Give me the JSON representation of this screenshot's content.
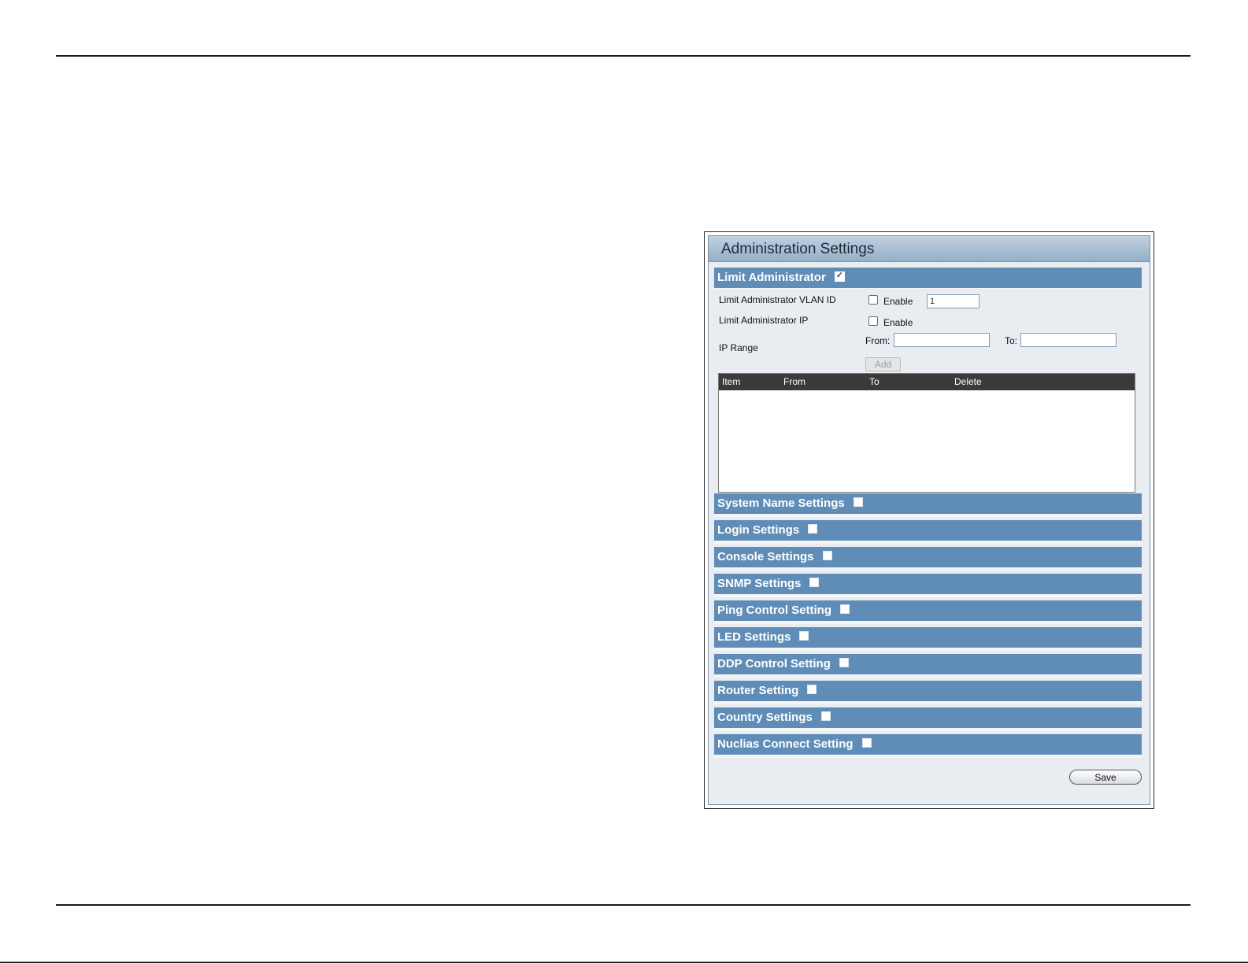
{
  "panel": {
    "title": "Administration Settings"
  },
  "limit_admin": {
    "title": "Limit Administrator",
    "checked": true,
    "vlan_label": "Limit Administrator VLAN ID",
    "vlan_enable_label": "Enable",
    "vlan_value": "1",
    "ip_label": "Limit Administrator IP",
    "ip_enable_label": "Enable",
    "range_label": "IP Range",
    "from_label": "From:",
    "to_label": "To:",
    "add_label": "Add",
    "table_headers": [
      "Item",
      "From",
      "To",
      "Delete"
    ]
  },
  "sections": [
    {
      "label": "System Name Settings"
    },
    {
      "label": "Login Settings"
    },
    {
      "label": "Console Settings"
    },
    {
      "label": "SNMP Settings"
    },
    {
      "label": "Ping Control Setting"
    },
    {
      "label": "LED Settings"
    },
    {
      "label": "DDP Control Setting"
    },
    {
      "label": "Router Setting"
    },
    {
      "label": "Country Settings"
    },
    {
      "label": "Nuclias Connect Setting"
    }
  ],
  "save_label": "Save"
}
